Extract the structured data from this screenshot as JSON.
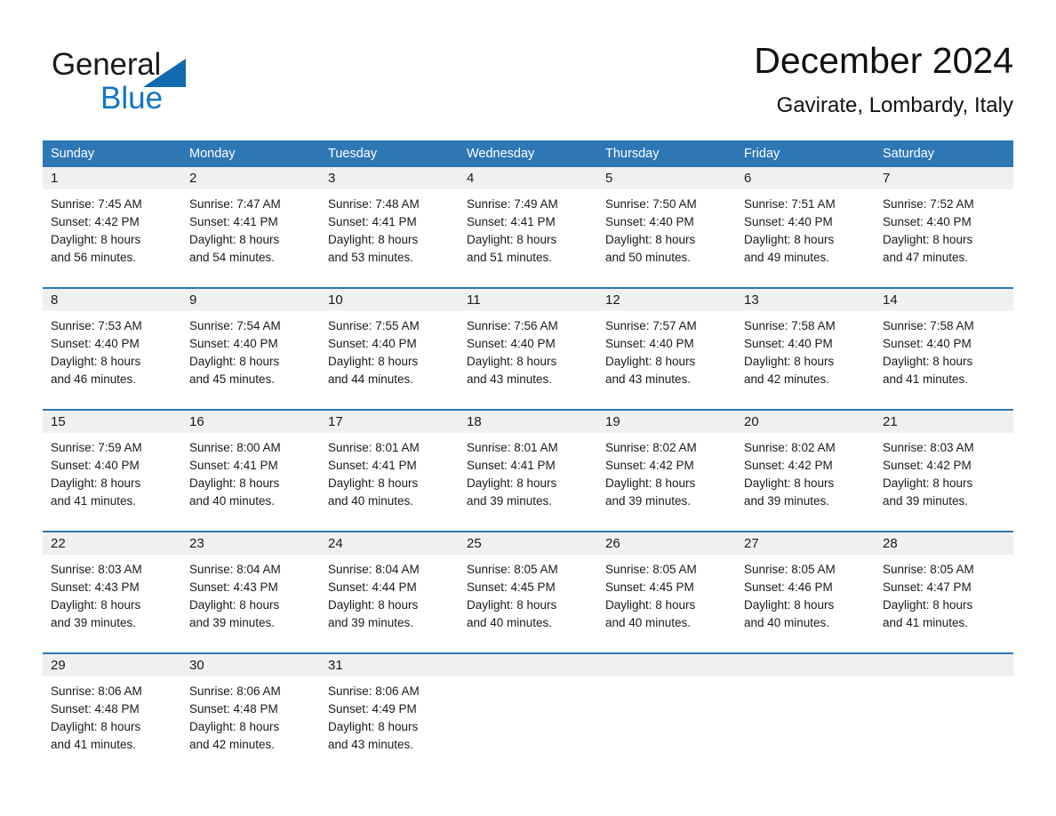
{
  "logo": {
    "word1": "General",
    "word2": "Blue",
    "triangle_color": "#1169b0",
    "word2_color": "#1176c4"
  },
  "header": {
    "month_title": "December 2024",
    "location": "Gavirate, Lombardy, Italy"
  },
  "theme": {
    "header_blue": "#2e77b5",
    "day_band_gray": "#f0f0f0",
    "page_background": "#ffffff"
  },
  "weekdays": [
    "Sunday",
    "Monday",
    "Tuesday",
    "Wednesday",
    "Thursday",
    "Friday",
    "Saturday"
  ],
  "weeks": [
    [
      {
        "day": "1",
        "sunrise": "Sunrise: 7:45 AM",
        "sunset": "Sunset: 4:42 PM",
        "daylight1": "Daylight: 8 hours",
        "daylight2": "and 56 minutes."
      },
      {
        "day": "2",
        "sunrise": "Sunrise: 7:47 AM",
        "sunset": "Sunset: 4:41 PM",
        "daylight1": "Daylight: 8 hours",
        "daylight2": "and 54 minutes."
      },
      {
        "day": "3",
        "sunrise": "Sunrise: 7:48 AM",
        "sunset": "Sunset: 4:41 PM",
        "daylight1": "Daylight: 8 hours",
        "daylight2": "and 53 minutes."
      },
      {
        "day": "4",
        "sunrise": "Sunrise: 7:49 AM",
        "sunset": "Sunset: 4:41 PM",
        "daylight1": "Daylight: 8 hours",
        "daylight2": "and 51 minutes."
      },
      {
        "day": "5",
        "sunrise": "Sunrise: 7:50 AM",
        "sunset": "Sunset: 4:40 PM",
        "daylight1": "Daylight: 8 hours",
        "daylight2": "and 50 minutes."
      },
      {
        "day": "6",
        "sunrise": "Sunrise: 7:51 AM",
        "sunset": "Sunset: 4:40 PM",
        "daylight1": "Daylight: 8 hours",
        "daylight2": "and 49 minutes."
      },
      {
        "day": "7",
        "sunrise": "Sunrise: 7:52 AM",
        "sunset": "Sunset: 4:40 PM",
        "daylight1": "Daylight: 8 hours",
        "daylight2": "and 47 minutes."
      }
    ],
    [
      {
        "day": "8",
        "sunrise": "Sunrise: 7:53 AM",
        "sunset": "Sunset: 4:40 PM",
        "daylight1": "Daylight: 8 hours",
        "daylight2": "and 46 minutes."
      },
      {
        "day": "9",
        "sunrise": "Sunrise: 7:54 AM",
        "sunset": "Sunset: 4:40 PM",
        "daylight1": "Daylight: 8 hours",
        "daylight2": "and 45 minutes."
      },
      {
        "day": "10",
        "sunrise": "Sunrise: 7:55 AM",
        "sunset": "Sunset: 4:40 PM",
        "daylight1": "Daylight: 8 hours",
        "daylight2": "and 44 minutes."
      },
      {
        "day": "11",
        "sunrise": "Sunrise: 7:56 AM",
        "sunset": "Sunset: 4:40 PM",
        "daylight1": "Daylight: 8 hours",
        "daylight2": "and 43 minutes."
      },
      {
        "day": "12",
        "sunrise": "Sunrise: 7:57 AM",
        "sunset": "Sunset: 4:40 PM",
        "daylight1": "Daylight: 8 hours",
        "daylight2": "and 43 minutes."
      },
      {
        "day": "13",
        "sunrise": "Sunrise: 7:58 AM",
        "sunset": "Sunset: 4:40 PM",
        "daylight1": "Daylight: 8 hours",
        "daylight2": "and 42 minutes."
      },
      {
        "day": "14",
        "sunrise": "Sunrise: 7:58 AM",
        "sunset": "Sunset: 4:40 PM",
        "daylight1": "Daylight: 8 hours",
        "daylight2": "and 41 minutes."
      }
    ],
    [
      {
        "day": "15",
        "sunrise": "Sunrise: 7:59 AM",
        "sunset": "Sunset: 4:40 PM",
        "daylight1": "Daylight: 8 hours",
        "daylight2": "and 41 minutes."
      },
      {
        "day": "16",
        "sunrise": "Sunrise: 8:00 AM",
        "sunset": "Sunset: 4:41 PM",
        "daylight1": "Daylight: 8 hours",
        "daylight2": "and 40 minutes."
      },
      {
        "day": "17",
        "sunrise": "Sunrise: 8:01 AM",
        "sunset": "Sunset: 4:41 PM",
        "daylight1": "Daylight: 8 hours",
        "daylight2": "and 40 minutes."
      },
      {
        "day": "18",
        "sunrise": "Sunrise: 8:01 AM",
        "sunset": "Sunset: 4:41 PM",
        "daylight1": "Daylight: 8 hours",
        "daylight2": "and 39 minutes."
      },
      {
        "day": "19",
        "sunrise": "Sunrise: 8:02 AM",
        "sunset": "Sunset: 4:42 PM",
        "daylight1": "Daylight: 8 hours",
        "daylight2": "and 39 minutes."
      },
      {
        "day": "20",
        "sunrise": "Sunrise: 8:02 AM",
        "sunset": "Sunset: 4:42 PM",
        "daylight1": "Daylight: 8 hours",
        "daylight2": "and 39 minutes."
      },
      {
        "day": "21",
        "sunrise": "Sunrise: 8:03 AM",
        "sunset": "Sunset: 4:42 PM",
        "daylight1": "Daylight: 8 hours",
        "daylight2": "and 39 minutes."
      }
    ],
    [
      {
        "day": "22",
        "sunrise": "Sunrise: 8:03 AM",
        "sunset": "Sunset: 4:43 PM",
        "daylight1": "Daylight: 8 hours",
        "daylight2": "and 39 minutes."
      },
      {
        "day": "23",
        "sunrise": "Sunrise: 8:04 AM",
        "sunset": "Sunset: 4:43 PM",
        "daylight1": "Daylight: 8 hours",
        "daylight2": "and 39 minutes."
      },
      {
        "day": "24",
        "sunrise": "Sunrise: 8:04 AM",
        "sunset": "Sunset: 4:44 PM",
        "daylight1": "Daylight: 8 hours",
        "daylight2": "and 39 minutes."
      },
      {
        "day": "25",
        "sunrise": "Sunrise: 8:05 AM",
        "sunset": "Sunset: 4:45 PM",
        "daylight1": "Daylight: 8 hours",
        "daylight2": "and 40 minutes."
      },
      {
        "day": "26",
        "sunrise": "Sunrise: 8:05 AM",
        "sunset": "Sunset: 4:45 PM",
        "daylight1": "Daylight: 8 hours",
        "daylight2": "and 40 minutes."
      },
      {
        "day": "27",
        "sunrise": "Sunrise: 8:05 AM",
        "sunset": "Sunset: 4:46 PM",
        "daylight1": "Daylight: 8 hours",
        "daylight2": "and 40 minutes."
      },
      {
        "day": "28",
        "sunrise": "Sunrise: 8:05 AM",
        "sunset": "Sunset: 4:47 PM",
        "daylight1": "Daylight: 8 hours",
        "daylight2": "and 41 minutes."
      }
    ],
    [
      {
        "day": "29",
        "sunrise": "Sunrise: 8:06 AM",
        "sunset": "Sunset: 4:48 PM",
        "daylight1": "Daylight: 8 hours",
        "daylight2": "and 41 minutes."
      },
      {
        "day": "30",
        "sunrise": "Sunrise: 8:06 AM",
        "sunset": "Sunset: 4:48 PM",
        "daylight1": "Daylight: 8 hours",
        "daylight2": "and 42 minutes."
      },
      {
        "day": "31",
        "sunrise": "Sunrise: 8:06 AM",
        "sunset": "Sunset: 4:49 PM",
        "daylight1": "Daylight: 8 hours",
        "daylight2": "and 43 minutes."
      },
      {
        "day": "",
        "sunrise": "",
        "sunset": "",
        "daylight1": "",
        "daylight2": ""
      },
      {
        "day": "",
        "sunrise": "",
        "sunset": "",
        "daylight1": "",
        "daylight2": ""
      },
      {
        "day": "",
        "sunrise": "",
        "sunset": "",
        "daylight1": "",
        "daylight2": ""
      },
      {
        "day": "",
        "sunrise": "",
        "sunset": "",
        "daylight1": "",
        "daylight2": ""
      }
    ]
  ]
}
